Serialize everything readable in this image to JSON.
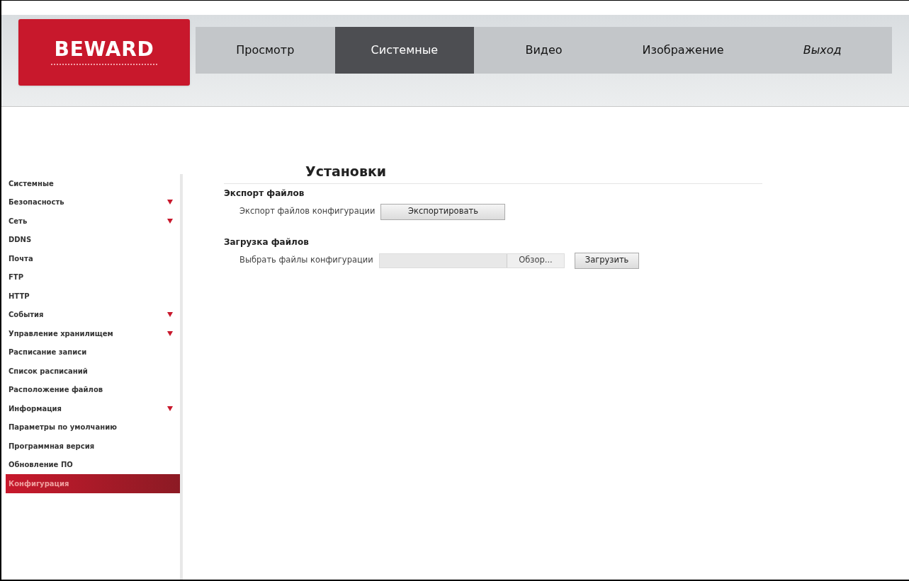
{
  "logo": {
    "text": "BEWARD"
  },
  "tabs": [
    {
      "label": "Просмотр",
      "selected": false,
      "italic": false
    },
    {
      "label": "Системные",
      "selected": true,
      "italic": false
    },
    {
      "label": "Видео",
      "selected": false,
      "italic": false
    },
    {
      "label": "Изображение",
      "selected": false,
      "italic": false
    },
    {
      "label": "Выход",
      "selected": false,
      "italic": true
    }
  ],
  "sidebar": {
    "items": [
      {
        "label": "Системные",
        "expandable": false,
        "selected": false
      },
      {
        "label": "Безопасность",
        "expandable": true,
        "selected": false
      },
      {
        "label": "Сеть",
        "expandable": true,
        "selected": false
      },
      {
        "label": "DDNS",
        "expandable": false,
        "selected": false
      },
      {
        "label": "Почта",
        "expandable": false,
        "selected": false
      },
      {
        "label": "FTP",
        "expandable": false,
        "selected": false
      },
      {
        "label": "HTTP",
        "expandable": false,
        "selected": false
      },
      {
        "label": "События",
        "expandable": true,
        "selected": false
      },
      {
        "label": "Управление хранилищем",
        "expandable": true,
        "selected": false
      },
      {
        "label": "Расписание записи",
        "expandable": false,
        "selected": false
      },
      {
        "label": "Список расписаний",
        "expandable": false,
        "selected": false
      },
      {
        "label": "Расположение файлов",
        "expandable": false,
        "selected": false
      },
      {
        "label": "Информация",
        "expandable": true,
        "selected": false
      },
      {
        "label": "Параметры по умолчанию",
        "expandable": false,
        "selected": false
      },
      {
        "label": "Программная версия",
        "expandable": false,
        "selected": false
      },
      {
        "label": "Обновление ПО",
        "expandable": false,
        "selected": false
      },
      {
        "label": "Конфигурация",
        "expandable": false,
        "selected": true
      }
    ]
  },
  "content": {
    "title": "Установки",
    "sections": [
      {
        "heading": "Экспорт файлов",
        "kind": "export",
        "label": "Экспорт файлов конфигурации",
        "button": "Экспортировать"
      },
      {
        "heading": "Загрузка файлов",
        "kind": "upload",
        "label": "Выбрать файлы конфигурации",
        "browse": "Обзор...",
        "button": "Загрузить"
      }
    ]
  }
}
